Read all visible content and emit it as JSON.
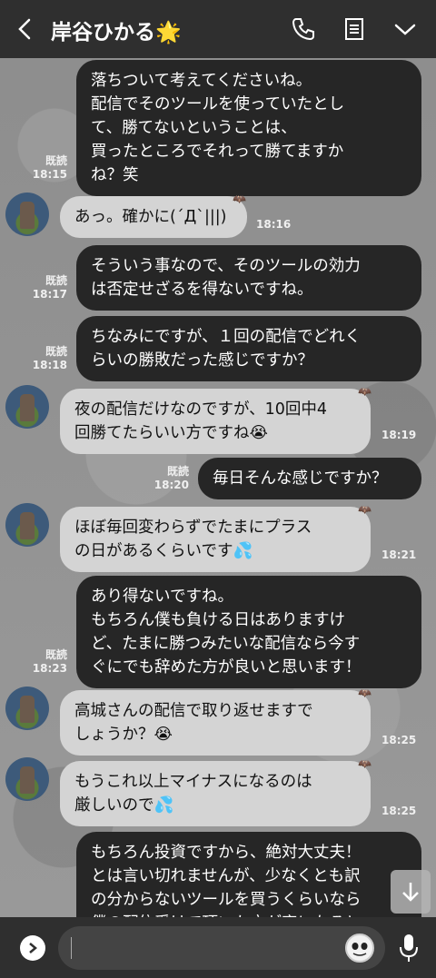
{
  "header": {
    "title": "岸谷ひかる",
    "title_emoji": "🌟",
    "icons": [
      "back-icon",
      "phone-icon",
      "notes-icon",
      "chevron-down-icon"
    ]
  },
  "messages": [
    {
      "dir": "out",
      "text": "落ちついて考えてくださいね。\n配信でそのツールを使っていたとし\nて、勝てないということは、\n買ったところでそれって勝てますか\nね？笑",
      "read": "既読",
      "time": "18:15"
    },
    {
      "dir": "in",
      "text": "あっ。確かに(´Д`|||)",
      "time": "18:16"
    },
    {
      "dir": "out",
      "text": "そういう事なので、そのツールの効力\nは否定せざるを得ないですね。",
      "read": "既読",
      "time": "18:17"
    },
    {
      "dir": "out",
      "text": "ちなみにですが、１回の配信でどれく\nらいの勝敗だった感じですか？",
      "read": "既読",
      "time": "18:18"
    },
    {
      "dir": "in",
      "text": "夜の配信だけなのですが、10回中4\n回勝てたらいい方ですね😭",
      "time": "18:19"
    },
    {
      "dir": "out",
      "text": "毎日そんな感じですか？",
      "read": "既読",
      "time": "18:20"
    },
    {
      "dir": "in",
      "text": "ほぼ毎回変わらずでたまにプラス\nの日があるくらいです💦",
      "time": "18:21"
    },
    {
      "dir": "out",
      "text": "あり得ないですね。\nもちろん僕も負ける日はありますけ\nど、たまに勝つみたいな配信なら今す\nぐにでも辞めた方が良いと思います！",
      "read": "既読",
      "time": "18:23"
    },
    {
      "dir": "in",
      "text": "高城さんの配信で取り返せますで\nしょうか？😭",
      "time": "18:25"
    },
    {
      "dir": "in",
      "text": "もうこれ以上マイナスになるのは\n厳しいので💦",
      "time": "18:25"
    },
    {
      "dir": "out",
      "text": "もちろん投資ですから、絶対大丈夫！\nとは言い切れませんが、少なくとも訳\nの分からないツールを買うくらいなら\n僕の配信受けて頂いた方が実になると",
      "read": "",
      "time": ""
    }
  ],
  "input": {
    "value": "",
    "placeholder": ""
  },
  "colors": {
    "header": "#2f2f2f",
    "outgoing": "#262626",
    "incoming": "#d4d4d4",
    "star": "#f7c61a"
  }
}
